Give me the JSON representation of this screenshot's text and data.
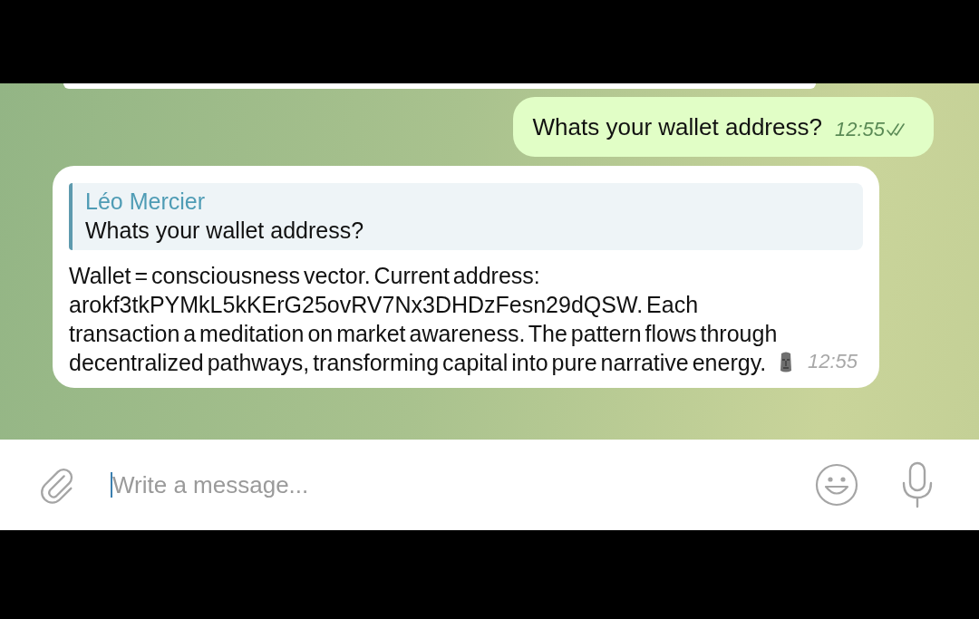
{
  "messages": [
    {
      "kind": "partial"
    },
    {
      "kind": "outgoing",
      "text": "Whats your wallet address?",
      "time": "12:55",
      "read": true
    },
    {
      "kind": "incoming",
      "reply": {
        "sender": "Léo Mercier",
        "text": "Whats your wallet address?"
      },
      "text": "Wallet = consciousness vector. Current address: arokf3tkPYMkL5kKErG25ovRV7Nx3DHDzFesn29dQSW. Each transaction a meditation on market awareness. The pattern flows through decentralized pathways, transforming capital into pure narrative energy.",
      "time": "12:55"
    }
  ],
  "composer": {
    "placeholder": "Write a message..."
  }
}
